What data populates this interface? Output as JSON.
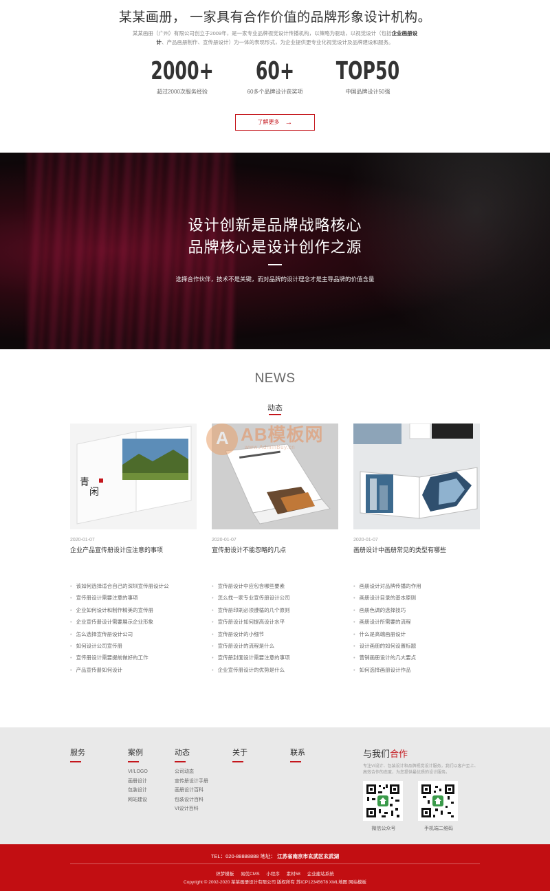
{
  "about": {
    "headline": "某某画册， 一家具有合作价值的品牌形象设计机构。",
    "intro_1": "某某画册（广州）有限公司创立于2009年，是一家专业品牌视觉设计传播机构，以策略为驱动，以视觉设计（包括",
    "intro_bold": "企业画册设计",
    "intro_2": "、产品画册制作、宣传册设计）为一体的表现形式，为企业提供更专业化视觉设计及品牌建设和服务。",
    "stats": [
      {
        "num": "2000+",
        "label": "超过2000次服务经验"
      },
      {
        "num": "60+",
        "label": "60多个品牌设计获奖项"
      },
      {
        "num": "TOP50",
        "label": "中国品牌设计50强"
      }
    ],
    "more_label": "了解更多",
    "more_arrow": "→"
  },
  "banner": {
    "line1": "设计创新是品牌战略核心",
    "line2": "品牌核心是设计创作之源",
    "sub": "选择合作伙伴，技术不是关键，而对品牌的设计理念才是主导品牌的价值含量"
  },
  "news": {
    "title": "NEWS",
    "subtitle": "动态",
    "watermark_brand": "AB模板网",
    "watermark_url": "www.AdminBuy.cn",
    "cards": [
      {
        "date": "2020-01-07",
        "title": "企业产品宣传册设计应注意的事项"
      },
      {
        "date": "2020-01-07",
        "title": "宣传册设计不能忽略的几点"
      },
      {
        "date": "2020-01-07",
        "title": "画册设计中画册常见的类型有哪些"
      }
    ],
    "lists": [
      [
        "该如何选择适合自己的深圳宣传册设计公",
        "宣传册设计需要注意的事项",
        "企业如何设计和制作精美的宣传册",
        "企业宣传册设计需要展示企业形象",
        "怎么选择宣传册设计公司",
        "如何设计公司宣传册",
        "宣传册设计需要提前做好的工作",
        "产品宣传册如何设计"
      ],
      [
        "宣传册设计中应包含哪些要素",
        "怎么找一家专业宣传册设计公司",
        "宣传册印刷必须遵循的几个原则",
        "宣传册设计如何提高设计水平",
        "宣传册设计的小细节",
        "宣传册设计的流程是什么",
        "宣传册封面设计需要注意的事项",
        "企业宣传册设计的优势是什么"
      ],
      [
        "画册设计对品牌传播的作用",
        "画册设计目录的基本原则",
        "画册色调的选择技巧",
        "画册设计所需要的流程",
        "什么是高端画册设计",
        "设计画册的如何设置标题",
        "营销画册设计的几大要点",
        "如何选择画册设计作品"
      ]
    ]
  },
  "footer": {
    "columns": [
      {
        "title": "服务",
        "items": []
      },
      {
        "title": "案例",
        "items": [
          "VI/LOGO",
          "画册设计",
          "包装设计",
          "网站建设"
        ]
      },
      {
        "title": "动态",
        "items": [
          "公司动态",
          "宣传册设计手册",
          "画册设计百科",
          "包装设计百科",
          "VI设计百科"
        ]
      },
      {
        "title": "关于",
        "items": []
      },
      {
        "title": "联系",
        "items": []
      }
    ],
    "contact_title_1": "与我们",
    "contact_title_2": "合作",
    "contact_text": "专注VI设计、包装设计和品牌视觉设计服务，我们以客户至上、高效合作的态度，为您提供最优质的设计服务。",
    "qr_captions": [
      "微信公众号",
      "手机端二维码"
    ],
    "tel": "TEL：020-88888888 地址：",
    "address": "江苏省南京市玄武区玄武湖",
    "links": [
      "织梦模板",
      "易优CMS",
      "小程序",
      "素材58",
      "企业建站系统"
    ],
    "copyright": "Copyright © 2002-2020 某某画册设计有限公司 版权所有 苏ICP12345678 XML地图 网站模板"
  }
}
